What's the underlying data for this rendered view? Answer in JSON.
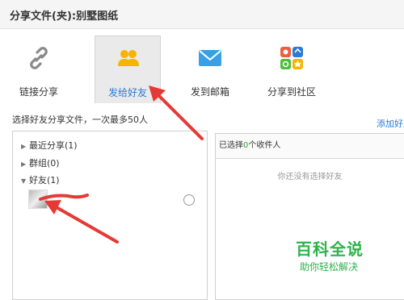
{
  "window": {
    "title": "分享文件(夹):别墅图纸"
  },
  "tabs": [
    {
      "label": "链接分享",
      "icon": "link-icon"
    },
    {
      "label": "发给好友",
      "icon": "friends-icon",
      "active": true
    },
    {
      "label": "发到邮箱",
      "icon": "email-icon"
    },
    {
      "label": "分享到社区",
      "icon": "community-icon"
    }
  ],
  "instructions": "选择好友分享文件，一次最多50人",
  "add_friend_link": "添加好友",
  "friend_tree": [
    {
      "label": "最近分享(1)",
      "expanded": false
    },
    {
      "label": "群组(0)",
      "expanded": false
    },
    {
      "label": "好友(1)",
      "expanded": true
    }
  ],
  "selected_panel": {
    "prefix": "已选择",
    "count": "0",
    "suffix": "个收件人",
    "empty_text": "你还没有选择好友"
  },
  "watermark": {
    "title": "百科全说",
    "subtitle": "助你轻松解决"
  },
  "colors": {
    "accent": "#2a7ad6",
    "count": "#2fa32f",
    "annotation": "#e53935",
    "watermark": "#2cb34a"
  }
}
